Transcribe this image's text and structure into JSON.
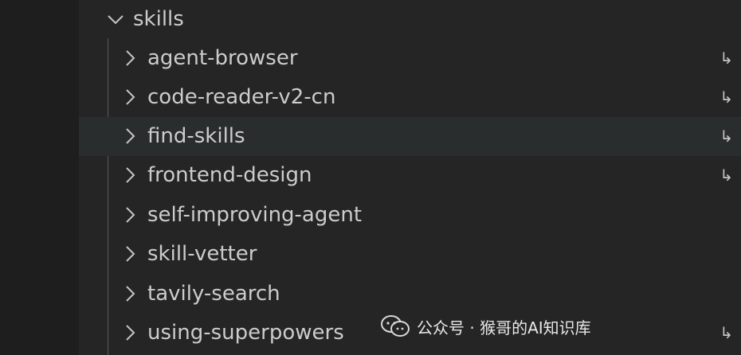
{
  "explorer": {
    "folder": {
      "label": "skills",
      "icon": "chevron-down-icon",
      "expanded": true
    },
    "items": [
      {
        "label": "agent-browser",
        "symlink": true,
        "symlink_icon": "↳"
      },
      {
        "label": "code-reader-v2-cn",
        "symlink": true,
        "symlink_icon": "↳"
      },
      {
        "label": "find-skills",
        "symlink": true,
        "symlink_icon": "↳",
        "hovered": true
      },
      {
        "label": "frontend-design",
        "symlink": true,
        "symlink_icon": "↳"
      },
      {
        "label": "self-improving-agent",
        "symlink": false
      },
      {
        "label": "skill-vetter",
        "symlink": false
      },
      {
        "label": "tavily-search",
        "symlink": false
      },
      {
        "label": "using-superpowers",
        "symlink": true,
        "symlink_icon": "↳"
      }
    ]
  },
  "watermark": {
    "text": "公众号 · 猴哥的AI知识库",
    "icon": "wechat-icon"
  },
  "colors": {
    "background": "#252526",
    "left_strip": "#1e1e1e",
    "hover_row": "#2a2d2e",
    "text": "#cccccc",
    "indent_guide": "#585858"
  }
}
